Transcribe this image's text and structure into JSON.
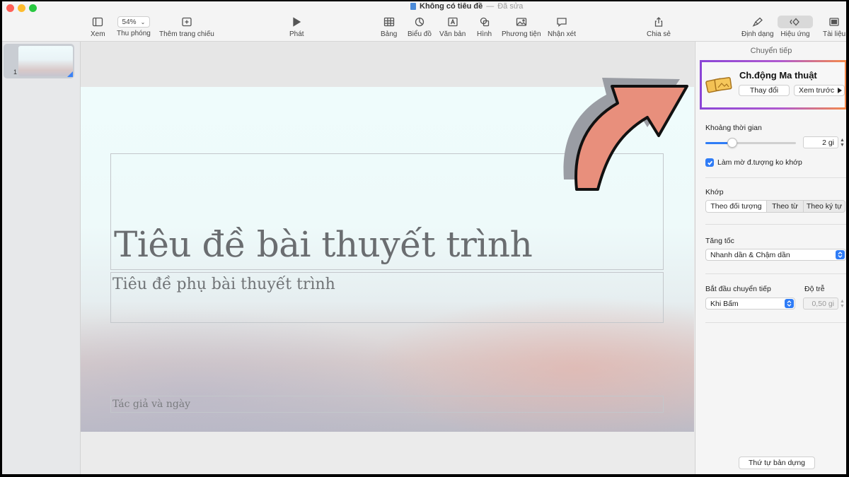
{
  "window": {
    "title": "Không có tiêu đề",
    "separator": "—",
    "status": "Đã sửa"
  },
  "toolbar": {
    "view_label": "Xem",
    "zoom_value": "54%",
    "zoom_label": "Thu phóng",
    "add_slide_label": "Thêm trang chiếu",
    "play_label": "Phát",
    "table_label": "Bảng",
    "chart_label": "Biểu đồ",
    "text_label": "Văn bản",
    "shape_label": "Hình",
    "media_label": "Phương tiện",
    "comment_label": "Nhận xét",
    "share_label": "Chia sẻ",
    "format_label": "Định dạng",
    "animate_label": "Hiệu ứng",
    "document_label": "Tài liệu"
  },
  "navigator": {
    "slide_number": "1"
  },
  "slide": {
    "title": "Tiêu đề bài thuyết trình",
    "subtitle": "Tiêu đề phụ bài thuyết trình",
    "author": "Tác giả và ngày"
  },
  "inspector": {
    "header": "Chuyển tiếp",
    "effect_name": "Ch.động Ma thuật",
    "change_label": "Thay đổi",
    "preview_label": "Xem trước",
    "duration_label": "Khoảng thời gian",
    "duration_value": "2 gi",
    "duration_fraction": 0.3,
    "fade_checked": true,
    "fade_label": "Làm mờ đ.tượng ko khớp",
    "match_label": "Khớp",
    "match_options": [
      "Theo đối tượng",
      "Theo từ",
      "Theo ký tự"
    ],
    "match_selected": 0,
    "accel_label": "Tăng tốc",
    "accel_value": "Nhanh dần & Chậm dần",
    "start_label": "Bắt đầu chuyển tiếp",
    "start_value": "Khi Bấm",
    "delay_label": "Độ trễ",
    "delay_value": "0,50 gi",
    "order_label": "Thứ tự bản dựng"
  },
  "colors": {
    "accent": "#2f7cf6",
    "highlight_start": "#8b45d6",
    "highlight_end": "#f4894a",
    "arrow_fill": "#e88f7c"
  }
}
